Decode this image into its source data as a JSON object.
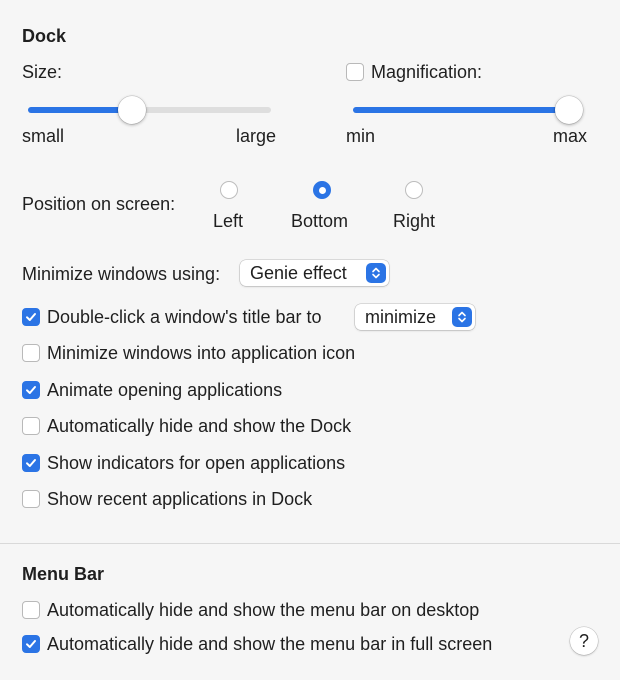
{
  "dock": {
    "title": "Dock",
    "size": {
      "label": "Size:",
      "min_label": "small",
      "max_label": "large",
      "value": 0.43
    },
    "magnification": {
      "label": "Magnification:",
      "checked": false,
      "min_label": "min",
      "max_label": "max",
      "value": 1.0
    },
    "position": {
      "label": "Position on screen:",
      "options": [
        "Left",
        "Bottom",
        "Right"
      ],
      "selected": "Bottom"
    },
    "minimize_using": {
      "label": "Minimize windows using:",
      "value": "Genie effect"
    },
    "double_click": {
      "label": "Double-click a window's title bar to",
      "checked": true,
      "value": "minimize"
    },
    "options": [
      {
        "label": "Minimize windows into application icon",
        "checked": false
      },
      {
        "label": "Animate opening applications",
        "checked": true
      },
      {
        "label": "Automatically hide and show the Dock",
        "checked": false
      },
      {
        "label": "Show indicators for open applications",
        "checked": true
      },
      {
        "label": "Show recent applications in Dock",
        "checked": false
      }
    ]
  },
  "menu_bar": {
    "title": "Menu Bar",
    "options": [
      {
        "label": "Automatically hide and show the menu bar on desktop",
        "checked": false
      },
      {
        "label": "Automatically hide and show the menu bar in full screen",
        "checked": true
      }
    ]
  },
  "help": {
    "label": "?"
  },
  "colors": {
    "accent": "#2b74e5",
    "background": "#f6f6f6",
    "divider": "#d9d9d9"
  },
  "icons": {
    "checkbox_check": "checkmark-icon",
    "popup_stepper": "chevron-up-down-icon"
  }
}
